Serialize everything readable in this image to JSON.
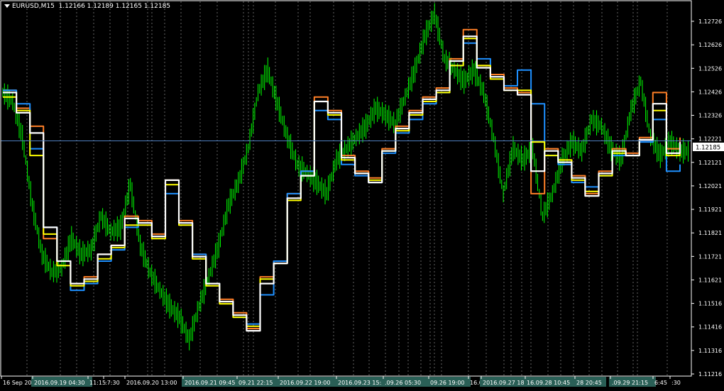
{
  "title": {
    "symbol_timeframe": "EURUSD,M15",
    "ohlc": "1.12166 1.12189 1.12165 1.12185"
  },
  "colors": {
    "background": "#000000",
    "frame": "#ffffff",
    "grid": "#b0b0b0",
    "price_series": "#00ff00",
    "line_white": "#ffffff",
    "line_yellow": "#ffff00",
    "line_orange": "#ff7f27",
    "line_blue": "#1e90ff",
    "current_price_line": "#4f7fbf",
    "time_label_bg": "#2a5f56"
  },
  "price_axis": {
    "labels": [
      "1.12726",
      "1.12626",
      "1.12526",
      "1.12426",
      "1.12326",
      "1.12221",
      "1.12121",
      "1.12021",
      "1.11921",
      "1.11821",
      "1.11721",
      "1.11621",
      "1.11516",
      "1.11416",
      "1.11316",
      "1.11216"
    ]
  },
  "current_price": "1.12185",
  "time_axis": {
    "labels": [
      "16 Sep 20",
      "2016.09.19 04:30",
      "11:15",
      ":7:30",
      "2016.09.20 13:00",
      "2016.09.21 09:45",
      "09.21 22:15",
      "2016.09.22 19:00",
      "2016.09.23 15:30",
      ".09.26 05:30",
      "09.26 19:00",
      "16.0",
      "2016.09.27 18:30",
      "16.09.28 10:45",
      "28 20:45",
      ".09.29 21:15",
      "6:45",
      ":30"
    ]
  },
  "chart_data": {
    "type": "line",
    "series": [
      {
        "values": [
          1.1241,
          1.1233,
          1.1225,
          1.1175,
          1.1165,
          1.1155,
          1.1158,
          1.1168,
          1.1172,
          1.1185,
          1.1183,
          1.1177,
          1.1201,
          1.1183,
          1.1168,
          1.1155,
          1.1148,
          1.1142,
          1.1135,
          1.1158,
          1.1165,
          1.1195,
          1.1205,
          1.1238,
          1.1232,
          1.1212,
          1.1205,
          1.1202,
          1.1215,
          1.1225,
          1.1232,
          1.1238,
          1.1242,
          1.1255,
          1.1268,
          1.1252,
          1.1248,
          1.1242,
          1.124,
          1.1195,
          1.1215,
          1.121,
          1.1203,
          1.1195,
          1.1205,
          1.1215,
          1.1213,
          1.122,
          1.124,
          1.1215,
          1.122
        ]
      },
      {
        "values": [
          1.1241,
          1.1235,
          1.1215,
          1.118,
          1.1165,
          1.1152,
          1.1155,
          1.1165,
          1.117,
          1.118,
          1.1182,
          1.1176,
          1.1195,
          1.1182,
          1.1168,
          1.1155,
          1.1147,
          1.114,
          1.1137,
          1.115,
          1.1165,
          1.1195,
          1.1205,
          1.1232,
          1.1228,
          1.1208,
          1.1203,
          1.12,
          1.1213,
          1.1222,
          1.1228,
          1.1235,
          1.124,
          1.1252,
          1.1262,
          1.1255,
          1.1247,
          1.1243,
          1.125,
          1.1235,
          1.1212,
          1.1208,
          1.12,
          1.1198,
          1.1203,
          1.1212,
          1.1212,
          1.1218,
          1.1228,
          1.1205,
          1.1208
        ]
      },
      {
        "values": [
          1.1238,
          1.1232,
          1.1212,
          1.1177,
          1.1163,
          1.1154,
          1.1156,
          1.1166,
          1.1171,
          1.1181,
          1.1181,
          1.1175,
          1.1199,
          1.1181,
          1.1166,
          1.1154,
          1.1146,
          1.114,
          1.1136,
          1.1157,
          1.1164,
          1.1192,
          1.1203,
          1.1236,
          1.123,
          1.121,
          1.1204,
          1.1201,
          1.1214,
          1.1223,
          1.123,
          1.1236,
          1.124,
          1.1252,
          1.1264,
          1.1252,
          1.1246,
          1.1241,
          1.1241,
          1.1218,
          1.1212,
          1.121,
          1.1201,
          1.1196,
          1.1203,
          1.1213,
          1.1212,
          1.1219,
          1.1232,
          1.1212,
          1.1214
        ]
      },
      {
        "values": [
          1.124,
          1.1231,
          1.1222,
          1.118,
          1.1165,
          1.1155,
          1.1157,
          1.1168,
          1.1172,
          1.1184,
          1.1182,
          1.1176,
          1.1201,
          1.1182,
          1.1167,
          1.1155,
          1.1147,
          1.1141,
          1.1134,
          1.1155,
          1.1164,
          1.1193,
          1.1203,
          1.1236,
          1.1231,
          1.1211,
          1.1204,
          1.12,
          1.1214,
          1.1224,
          1.1231,
          1.1237,
          1.1241,
          1.1254,
          1.1265,
          1.1251,
          1.1247,
          1.1241,
          1.1239,
          1.1205,
          1.1214,
          1.1209,
          1.1202,
          1.1194,
          1.1204,
          1.1214,
          1.1212,
          1.1219,
          1.1235,
          1.1213,
          1.1218
        ]
      }
    ],
    "price": [
      1.124,
      1.1236,
      1.122,
      1.119,
      1.1168,
      1.116,
      1.1162,
      1.1175,
      1.1168,
      1.117,
      1.1185,
      1.1178,
      1.118,
      1.1199,
      1.1172,
      1.116,
      1.1152,
      1.1145,
      1.114,
      1.113,
      1.1145,
      1.1158,
      1.1172,
      1.119,
      1.12,
      1.1215,
      1.124,
      1.125,
      1.1235,
      1.122,
      1.1208,
      1.1204,
      1.12,
      1.1195,
      1.121,
      1.1215,
      1.122,
      1.1225,
      1.1233,
      1.123,
      1.1226,
      1.1238,
      1.125,
      1.1265,
      1.1275,
      1.1255,
      1.125,
      1.1245,
      1.125,
      1.124,
      1.122,
      1.1195,
      1.1215,
      1.121,
      1.1215,
      1.1185,
      1.1195,
      1.121,
      1.1218,
      1.1214,
      1.1228,
      1.1225,
      1.1215,
      1.121,
      1.1232,
      1.1245,
      1.122,
      1.1212,
      1.1218,
      1.1214
    ],
    "ylim": [
      1.1117,
      1.1278
    ]
  }
}
